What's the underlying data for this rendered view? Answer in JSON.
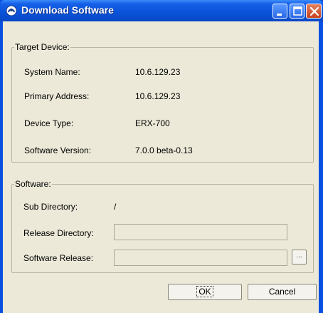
{
  "window": {
    "title": "Download Software",
    "icon": "app-logo-icon"
  },
  "target_device": {
    "legend": "Target Device:",
    "rows": [
      {
        "label": "System Name:",
        "value": "10.6.129.23"
      },
      {
        "label": "Primary Address:",
        "value": "10.6.129.23"
      },
      {
        "label": "Device Type:",
        "value": "ERX-700"
      },
      {
        "label": "Software Version:",
        "value": "7.0.0 beta-0.13"
      }
    ]
  },
  "software": {
    "legend": "Software:",
    "sub_directory_label": "Sub Directory:",
    "sub_directory_value": "/",
    "release_directory_label": "Release Directory:",
    "release_directory_value": "",
    "software_release_label": "Software Release:",
    "software_release_value": "",
    "browse_label": "..."
  },
  "buttons": {
    "ok": "OK",
    "cancel": "Cancel"
  }
}
